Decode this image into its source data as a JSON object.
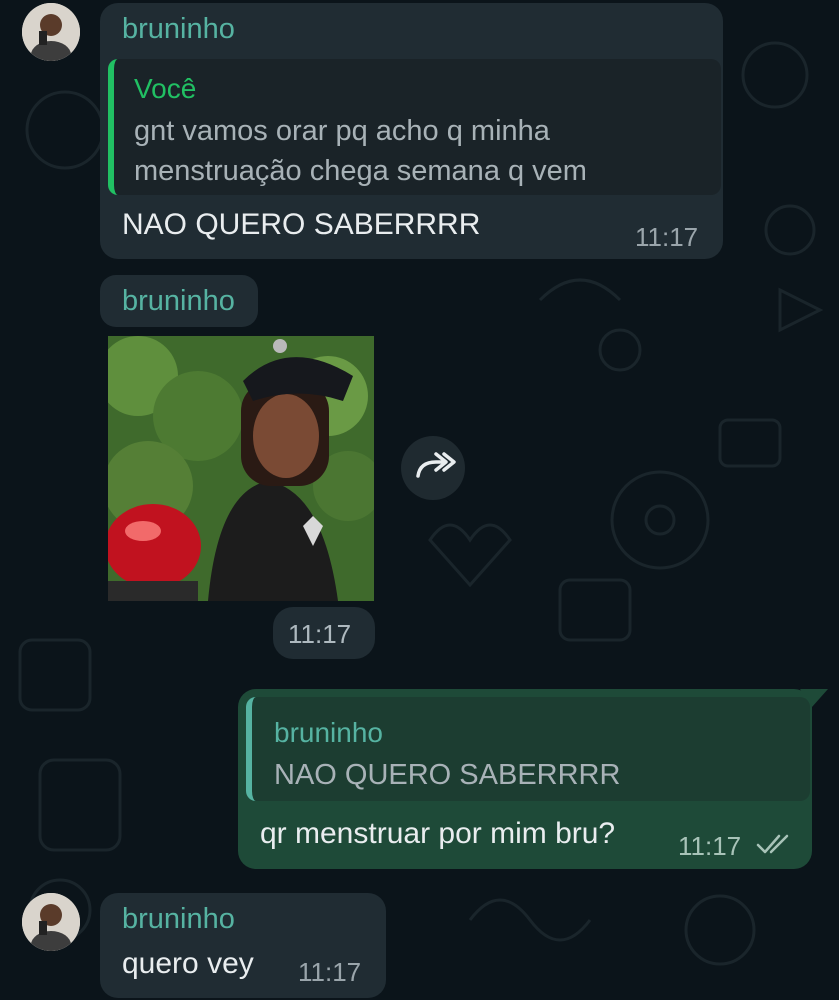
{
  "chat": {
    "messages": [
      {
        "type": "incoming",
        "sender": "bruninho",
        "quote_author": "Você",
        "quote_line1": "gnt vamos orar pq acho q minha",
        "quote_line2": "menstruação chega semana q vem",
        "text": "NAO QUERO SABERRRR",
        "time": "11:17"
      },
      {
        "type": "incoming-sticker",
        "sender": "bruninho",
        "time": "11:17"
      },
      {
        "type": "outgoing",
        "quote_author": "bruninho",
        "quote_text": "NAO QUERO SABERRRR",
        "text": "qr menstruar por mim bru?",
        "time": "11:17",
        "status": "read"
      },
      {
        "type": "incoming",
        "sender": "bruninho",
        "text": "quero vey",
        "time": "11:17"
      }
    ]
  },
  "icons": {
    "forward": "forward-icon",
    "read_receipt": "double-check-icon",
    "avatar": "avatar"
  },
  "colors": {
    "background": "#0b141a",
    "incoming_bubble": "#202c33",
    "outgoing_bubble": "#1e4a38",
    "sender_name": "#56b3a2",
    "quote_bar": "#21c063"
  }
}
